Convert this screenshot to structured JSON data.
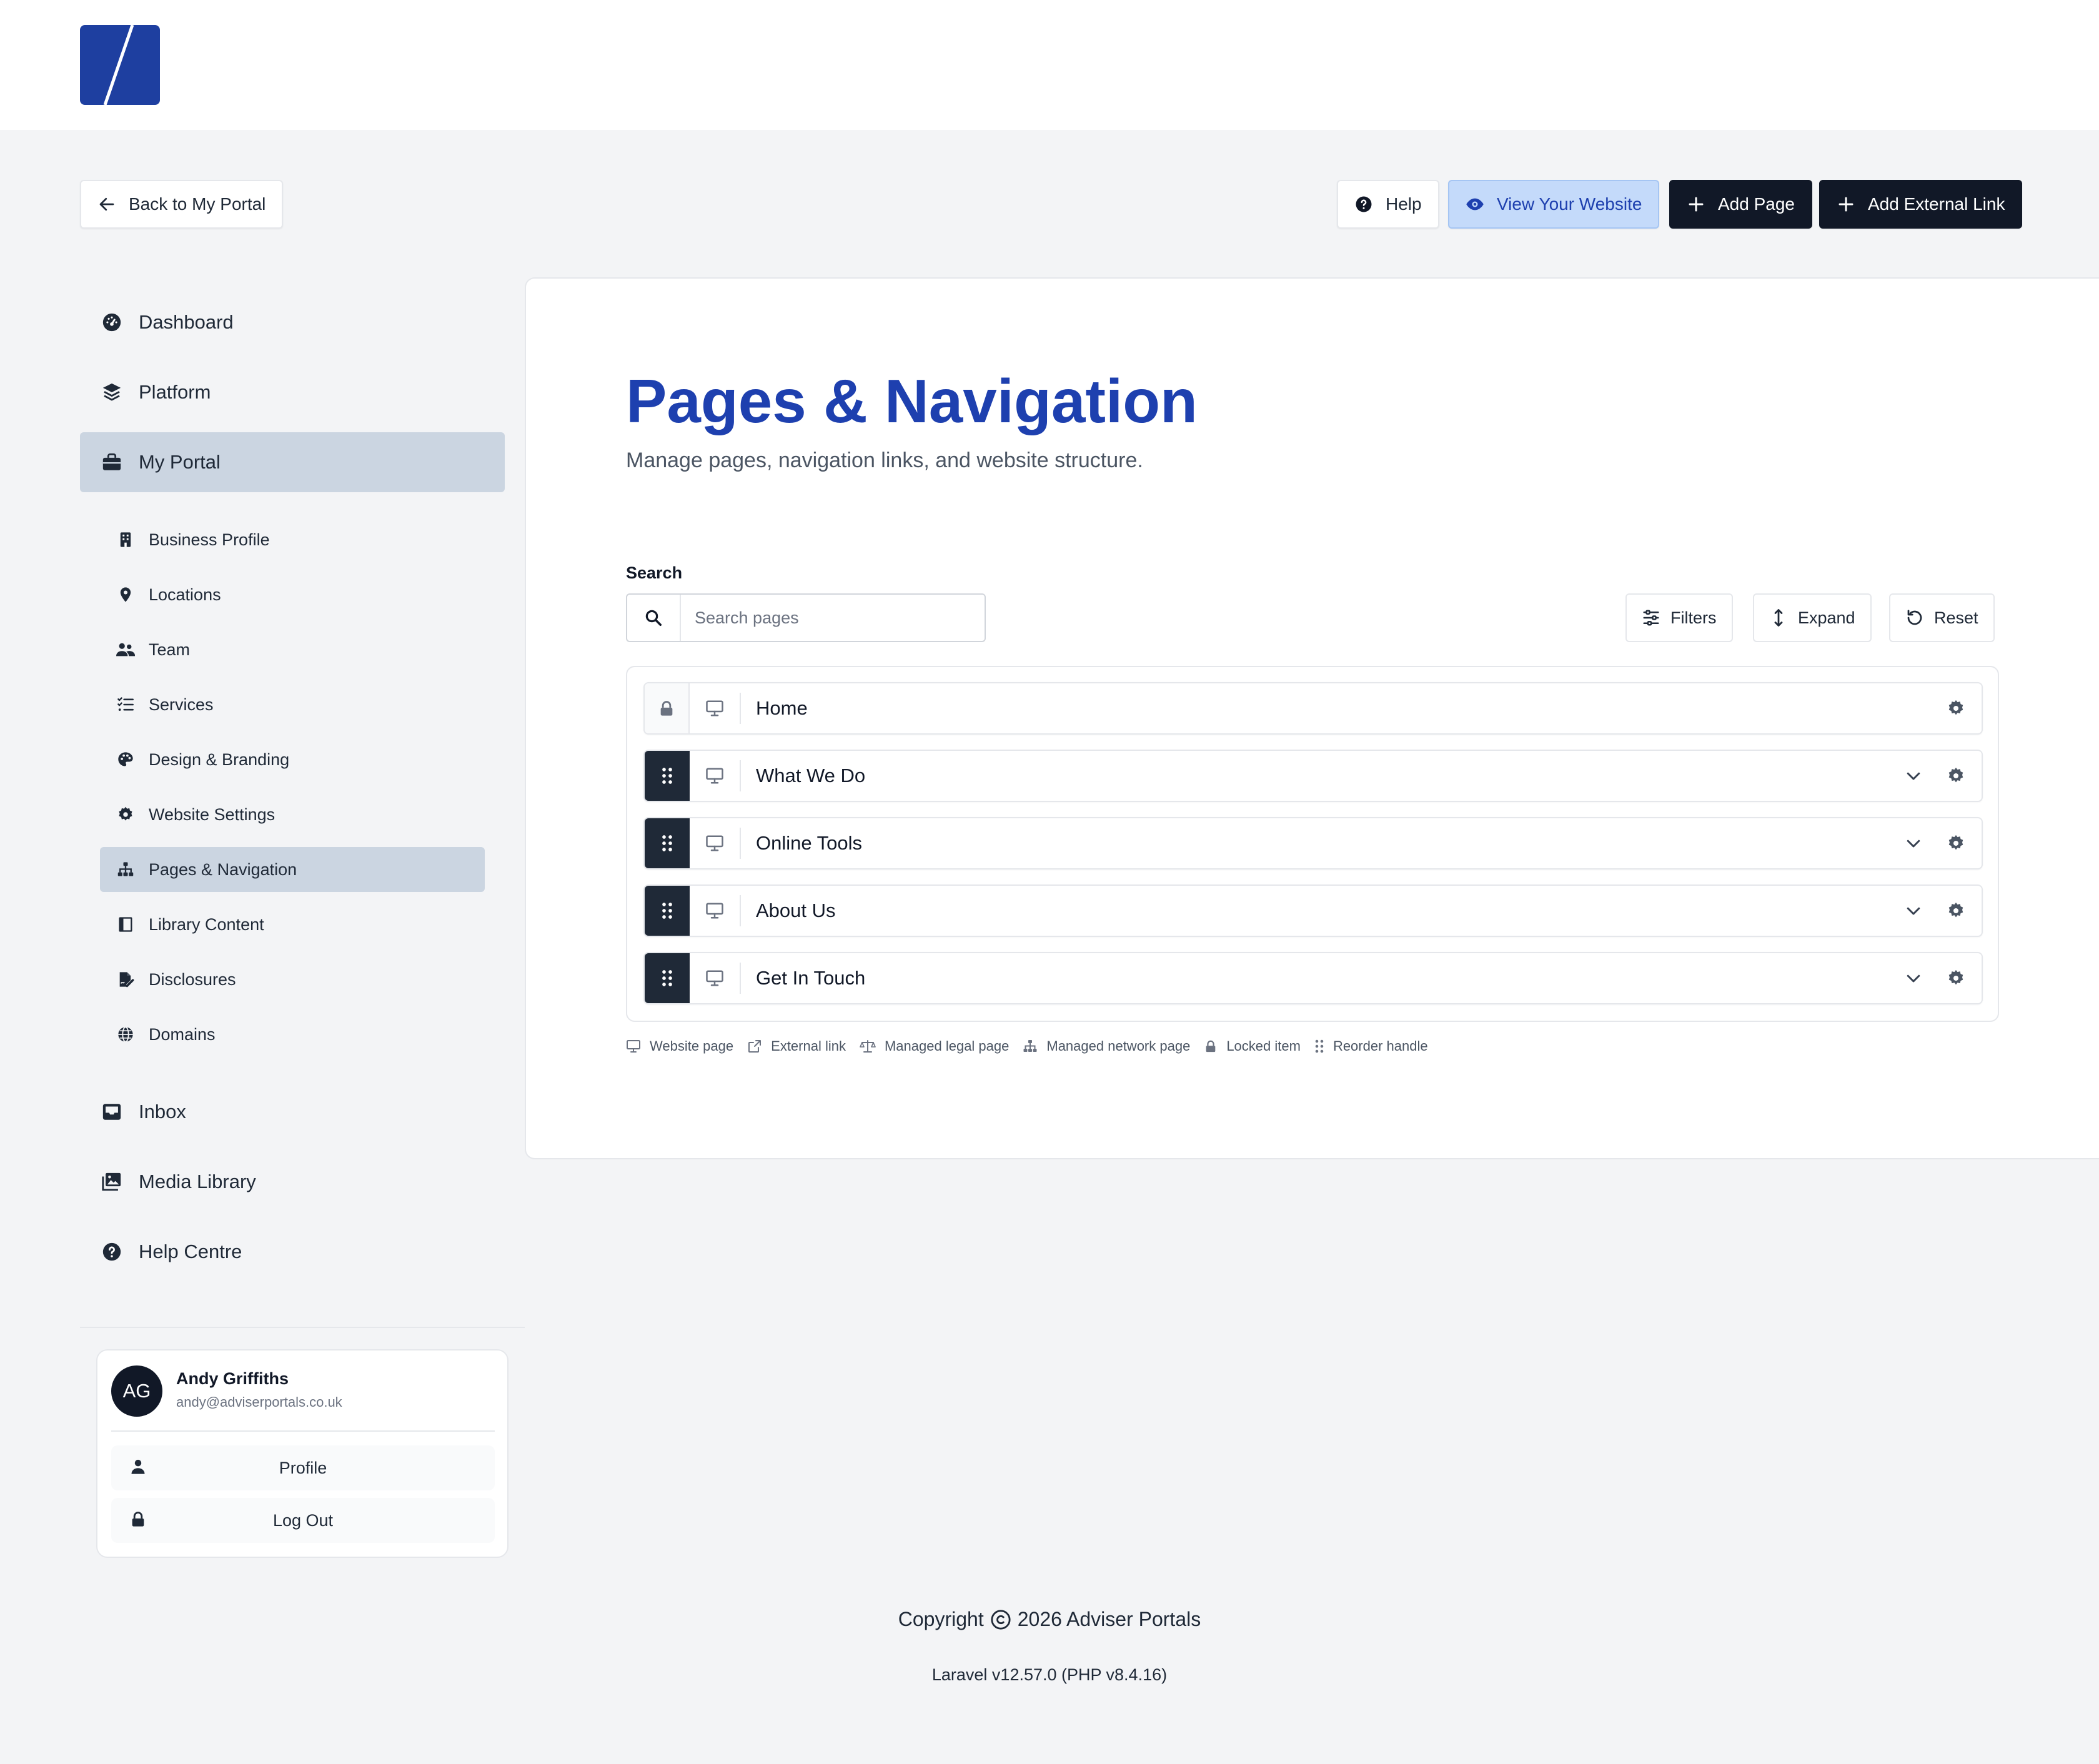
{
  "header": {
    "back_label": "Back to My Portal",
    "help_label": "Help",
    "view_website_label": "View Your Website",
    "add_page_label": "Add Page",
    "add_external_link_label": "Add External Link"
  },
  "sidebar": {
    "primary_top": [
      {
        "label": "Dashboard",
        "icon": "dashboard-icon"
      },
      {
        "label": "Platform",
        "icon": "layers-icon"
      },
      {
        "label": "My Portal",
        "icon": "briefcase-icon",
        "active": true
      }
    ],
    "sub_items": [
      {
        "label": "Business Profile",
        "icon": "building-icon"
      },
      {
        "label": "Locations",
        "icon": "map-pin-icon"
      },
      {
        "label": "Team",
        "icon": "users-icon"
      },
      {
        "label": "Services",
        "icon": "list-check-icon"
      },
      {
        "label": "Design & Branding",
        "icon": "palette-icon"
      },
      {
        "label": "Website Settings",
        "icon": "gear-icon"
      },
      {
        "label": "Pages & Navigation",
        "icon": "sitemap-icon",
        "active": true
      },
      {
        "label": "Library Content",
        "icon": "book-icon"
      },
      {
        "label": "Disclosures",
        "icon": "file-signature-icon"
      },
      {
        "label": "Domains",
        "icon": "globe-icon"
      }
    ],
    "primary_bottom": [
      {
        "label": "Inbox",
        "icon": "inbox-icon"
      },
      {
        "label": "Media Library",
        "icon": "images-icon"
      },
      {
        "label": "Help Centre",
        "icon": "question-circle-icon"
      }
    ]
  },
  "user": {
    "initials": "AG",
    "name": "Andy Griffiths",
    "email": "andy@adviserportals.co.uk",
    "profile_label": "Profile",
    "logout_label": "Log Out"
  },
  "main": {
    "title": "Pages & Navigation",
    "subtitle": "Manage pages, navigation links, and website structure.",
    "search": {
      "label": "Search",
      "placeholder": "Search pages"
    },
    "toolbar": {
      "filters_label": "Filters",
      "expand_label": "Expand",
      "reset_label": "Reset"
    },
    "pages": [
      {
        "label": "Home",
        "locked": true
      },
      {
        "label": "What We Do",
        "locked": false
      },
      {
        "label": "Online Tools",
        "locked": false
      },
      {
        "label": "About Us",
        "locked": false
      },
      {
        "label": "Get In Touch",
        "locked": false
      }
    ],
    "legend": [
      {
        "label": "Website page",
        "icon": "monitor-icon"
      },
      {
        "label": "External link",
        "icon": "external-link-icon"
      },
      {
        "label": "Managed legal page",
        "icon": "scale-icon"
      },
      {
        "label": "Managed network page",
        "icon": "sitemap-icon"
      },
      {
        "label": "Locked item",
        "icon": "lock-icon"
      },
      {
        "label": "Reorder handle",
        "icon": "grip-icon"
      }
    ]
  },
  "footer": {
    "copyright_prefix": "Copyright",
    "copyright_text": "2026 Adviser Portals",
    "version": "Laravel v12.57.0 (PHP v8.4.16)"
  },
  "colors": {
    "brand_blue": "#1e40af",
    "logo_blue": "#1e3fa0",
    "dark_button": "#111827",
    "active_nav": "#cbd5e1",
    "page_bg": "#f3f4f6"
  }
}
